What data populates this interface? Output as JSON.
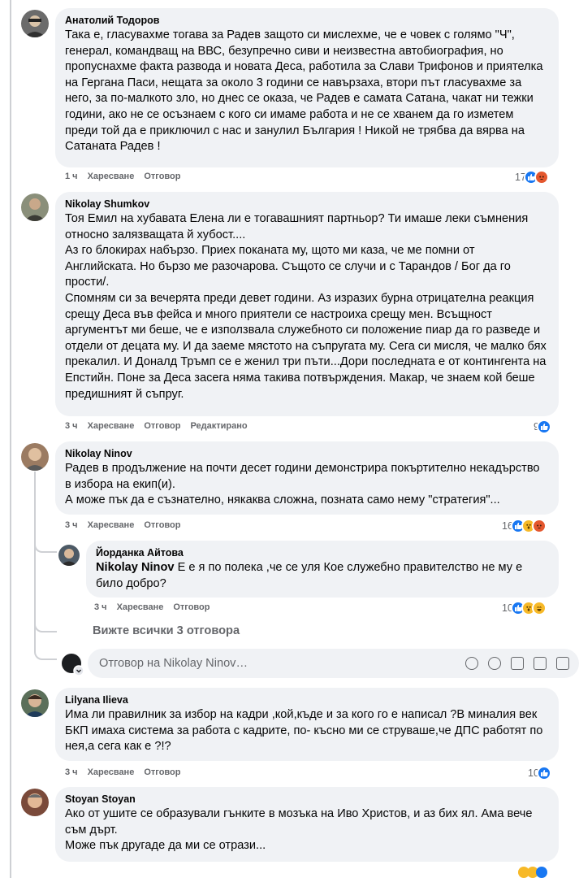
{
  "comments": [
    {
      "author": "Анатолий Тодоров",
      "lines": [
        "Така е, гласувахме тогава за Радев защото си мислехме, че е човек с голямо \"Ч\", генерал, командващ на ВВС, безупречно сиви и неизвестна автобиография, но пропуснахме факта развода и новата Деса, работила за Слави Трифонов и приятелка на Гергана Паси, нещата за около 3 години се навързаха, втори път гласувахме за него, за по-малкото зло, но днес се оказа, че Радев е самата Сатана, чакат ни тежки години, ако не се осъзнаем с кого си имаме работа и не се хванем да го изметем преди той да е приключил с нас и занулил България ! Никой не трябва да вярва на Сатаната Радев !"
      ],
      "time": "1 ч",
      "like": "Харесване",
      "reply": "Отговор",
      "edited": "",
      "reactions_count": "17",
      "reactions": [
        "like",
        "angry"
      ]
    },
    {
      "author": "Nikolay Shumkov",
      "lines": [
        "Тоя Емил на хубавата Елена ли е тогавашният партньор? Ти имаше леки съмнения относно залязващата й хубост....",
        "Аз го блокирах набързо. Приех поканата му, щото ми каза, че ме помни от Английската. Но бързо ме разочарова. Същото се случи и с Тарандов / Бог да го прости/.",
        "Спомням си за вечерята преди девет години. Аз изразих бурна отрицателна реакция срещу Деса във фейса и много приятели се настроиха срещу мен. Всъщност аргументът ми беше, че е използвала служебното си положение пиар да го разведе и отдели от децата му. И да заеме мястото на съпругата му. Сега си мисля, че малко бях прекалил. И Доналд Тръмп се е женил три пъти...Дори последната е от контингента на Епстийн. Поне за Деса засега няма такива потвърждения. Макар, че знаем кой беше предишният й съпруг."
      ],
      "time": "3 ч",
      "like": "Харесване",
      "reply": "Отговор",
      "edited": "Редактирано",
      "reactions_count": "9",
      "reactions": [
        "like"
      ]
    },
    {
      "author": "Nikolay Ninov",
      "lines": [
        "Радев в продължение на почти десет години демонстрира покъртително некадърство в избора на екип(и).",
        "А може пък да е съзнателно, някаква сложна, позната само нему \"стратегия\"..."
      ],
      "time": "3 ч",
      "like": "Харесване",
      "reply": "Отговор",
      "edited": "",
      "reactions_count": "16",
      "reactions": [
        "like",
        "wow",
        "angry"
      ]
    },
    {
      "author": "Lilyana Ilieva",
      "lines": [
        "Има ли правилник за избор на кадри ,кой,къде и за кого го е написал ?В миналия век БКП имаха система за работа с кадрите, по- късно ми се струваше,че ДПС работят по нея,а сега как е ?!?"
      ],
      "time": "3 ч",
      "like": "Харесване",
      "reply": "Отговор",
      "edited": "",
      "reactions_count": "10",
      "reactions": [
        "like"
      ]
    },
    {
      "author": "Stoyan Stoyan",
      "lines": [
        "Ако от ушите се образували гънките в мозъка на Иво Христов, и аз бих ял. Ама вече съм дърт.",
        "Може пък другаде да ми се отрази..."
      ]
    }
  ],
  "reply": {
    "author": "Йорданка Айтова",
    "mention": "Nikolay Ninov",
    "text": " Е е я по полека ,че се уля Кое служебно правителство не му е било добро?",
    "time": "3 ч",
    "like": "Харесване",
    "reply": "Отговор",
    "reactions_count": "10",
    "reactions": [
      "like",
      "wow",
      "wow"
    ]
  },
  "view_replies": "Вижте всички 3 отговора",
  "reply_input_placeholder": "Отговор на Nikolay Ninov…",
  "tool_icons": [
    "avatar-sticker-icon",
    "emoji-icon",
    "camera-icon",
    "gif-icon",
    "sticker-icon"
  ],
  "colors": {
    "like": "#1877f2",
    "angry": "#e4572e",
    "wow": "#f7b928",
    "bubble": "#f0f2f5",
    "meta": "#65676b"
  }
}
